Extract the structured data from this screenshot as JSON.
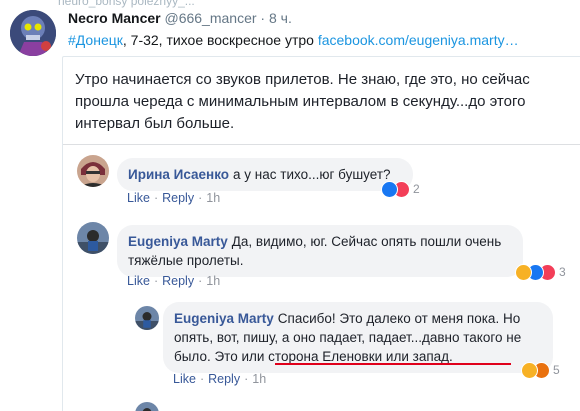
{
  "top_cut_text": "neuro_bonsy poleznyy_...",
  "tweet": {
    "name": "Necro Mancer",
    "handle": "@666_mancer",
    "dot": "·",
    "time": "8 ч.",
    "hashtag": "#Донецк",
    "text": ", 7-32, тихое воскресное утро ",
    "link": "facebook.com/eugeniya.marty…"
  },
  "post": {
    "text": "Утро начинается со звуков прилетов. Не знаю, где это, но сейчас прошла череда с минимальным интервалом в секунду...до этого интервал был больше."
  },
  "comments": [
    {
      "author": "Ирина Исаенко",
      "text": "а у нас тихо...юг бушует?",
      "actions": [
        "Like",
        "Reply"
      ],
      "time": "1h",
      "reactions": [
        "like",
        "love"
      ],
      "reaction_count": "2"
    },
    {
      "author": "Eugeniya Marty",
      "text": "Да, видимо, юг. Сейчас опять пошли очень тяжёлые пролеты.",
      "actions": [
        "Like",
        "Reply"
      ],
      "time": "1h",
      "reactions": [
        "sad",
        "like",
        "love"
      ],
      "reaction_count": "3"
    },
    {
      "author": "Eugeniya Marty",
      "text": "Спасибо! Это далеко от меня пока. Но опять, вот, пишу, а оно падает, падает...давно такого не было. Это или сторона Еленовки или запад.",
      "actions": [
        "Like",
        "Reply"
      ],
      "time": "1h",
      "reactions": [
        "sad",
        "angry"
      ],
      "reaction_count": "5"
    }
  ],
  "colors": {
    "link": "#1b95e0",
    "fb_author": "#385898",
    "like": "#1877f2",
    "love": "#f33e58",
    "sad": "#f7b125",
    "angry": "#e9710f",
    "underline": "#e0001b"
  }
}
